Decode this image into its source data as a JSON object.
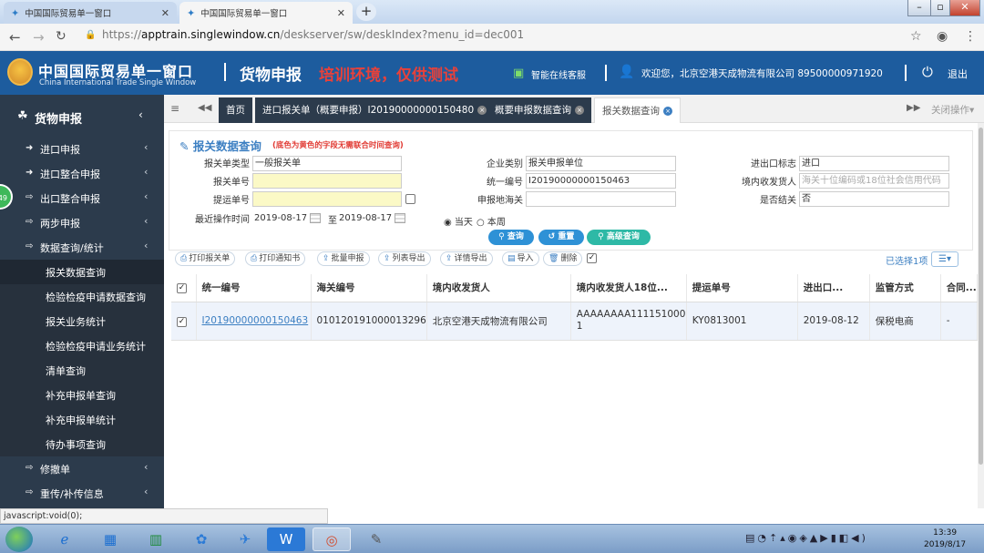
{
  "browser": {
    "tabs": [
      {
        "label": "中国国际贸易单一窗口",
        "active": false
      },
      {
        "label": "中国国际贸易单一窗口",
        "active": true
      }
    ],
    "url_scheme": "https://",
    "url_host": "apptrain.singlewindow.cn",
    "url_path": "/deskserver/sw/deskIndex?menu_id=dec001"
  },
  "header": {
    "logo_cn": "中国国际贸易单一窗口",
    "logo_en": "China International Trade Single Window",
    "title": "货物申报",
    "training": "培训环境，仅供测试",
    "service": "智能在线客服",
    "welcome": "欢迎您，北京空港天成物流有限公司 8950000097192​0",
    "logout": "退出"
  },
  "sidebar": {
    "title": "货物申报",
    "items": [
      {
        "label": "进口申报",
        "icon": "sign-in-icon"
      },
      {
        "label": "进口整合申报",
        "icon": "sign-in-icon"
      },
      {
        "label": "出口整合申报",
        "icon": "sign-out-icon"
      },
      {
        "label": "两步申报",
        "icon": "sign-out-icon"
      },
      {
        "label": "数据查询/统计",
        "icon": "sign-out-icon"
      }
    ],
    "subitems": [
      "报关数据查询",
      "检验检疫申请数据查询",
      "报关业务统计",
      "检验检疫申请业务统计",
      "清单查询",
      "补充申报单查询",
      "补充申报单统计",
      "待办事项查询"
    ],
    "bottom_items": [
      {
        "label": "修撤单",
        "icon": "sign-out-icon"
      },
      {
        "label": "重传/补传信息",
        "icon": "sign-out-icon"
      }
    ],
    "badge": "49"
  },
  "content_tabs": {
    "home": "首页",
    "tabs": [
      "进口报关单（概要申报）I20190000000150480",
      "概要申报数据查询",
      "报关数据查询"
    ],
    "close_ops": "关闭操作"
  },
  "panel": {
    "title": "报关数据查询",
    "note": "(底色为黄色的字段无需联合时间查询)",
    "fields": {
      "dec_type_label": "报关单类型",
      "dec_type_value": "一般报关单",
      "dec_no_label": "报关单号",
      "bl_no_label": "提运单号",
      "op_time_label": "最近操作时间",
      "date_from": "2019-08-17",
      "date_to_label": "至",
      "date_to": "2019-08-17",
      "ent_type_label": "企业类别",
      "ent_type_value": "报关申报单位",
      "unified_label": "统一编号",
      "unified_value": "I20190000000150463",
      "customs_label": "申报地海关",
      "ie_label": "进出口标志",
      "ie_value": "进口",
      "consignee_label": "境内收发货人",
      "consignee_placeholder": "海关十位编码或18位社会信用代码",
      "settled_label": "是否结关",
      "settled_value": "否"
    },
    "radio_today": "当天",
    "radio_week": "本周",
    "btn_query": "查询",
    "btn_reset": "重置",
    "btn_advanced": "高级查询"
  },
  "toolbar": {
    "buttons": [
      "打印报关单",
      "打印通知书",
      "批量申报",
      "列表导出",
      "详情导出",
      "导入",
      "删除"
    ],
    "selected": "已选择1项"
  },
  "table": {
    "headers": [
      "统一编号",
      "海关编号",
      "境内收发货人",
      "境内收发货人18位...",
      "提运单号",
      "进出口...",
      "监管方式",
      "合同..."
    ],
    "rows": [
      [
        "I20190000000150463",
        "010120191000013296",
        "北京空港天成物流有限公司",
        "AAAAAAAA1111510001",
        "KY0813001",
        "2019-08-12",
        "保税电商",
        "-"
      ]
    ]
  },
  "status_text": "javascript:void(0);",
  "taskbar": {
    "time": "13:39",
    "date": "2019/8/17"
  },
  "colors": {
    "header_blue": "#1d5c9e",
    "sidebar": "#2c3b4c",
    "accent": "#3c7fc2",
    "training_red": "#e8413a"
  }
}
